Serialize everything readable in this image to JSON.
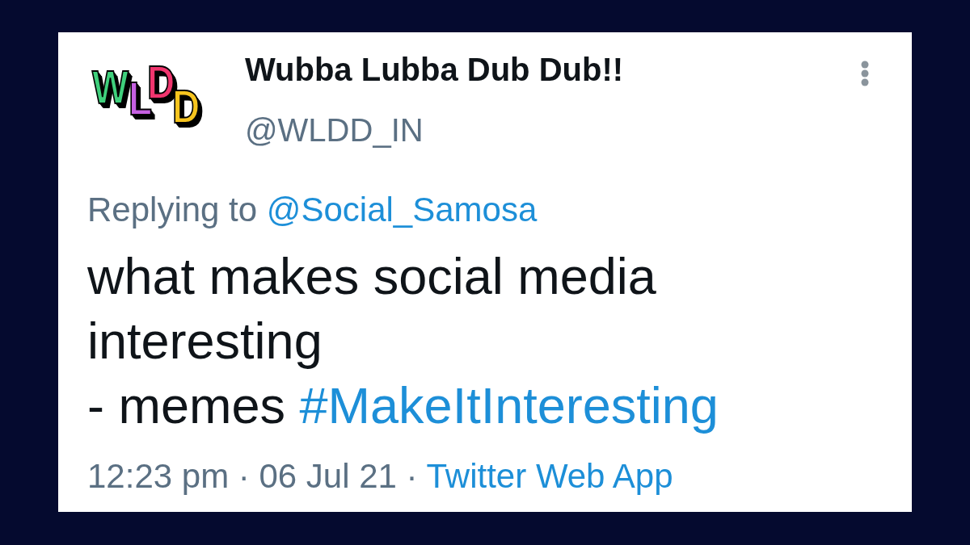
{
  "tweet": {
    "avatar": {
      "letters": [
        {
          "text": "W",
          "color": "#3fd07c"
        },
        {
          "text": "L",
          "color": "#c660e2"
        },
        {
          "text": "D",
          "color": "#f0356e"
        },
        {
          "text": "D",
          "color": "#f6c41e"
        }
      ]
    },
    "display_name": "Wubba Lubba Dub Dub!!",
    "handle": "@WLDD_IN",
    "reply_context": {
      "label": "Replying to",
      "mention": "@Social_Samosa"
    },
    "body": [
      {
        "kind": "text",
        "text": "what makes social media\ninteresting\n- memes"
      },
      {
        "kind": "hashtag",
        "text": "#MakeItInteresting"
      }
    ],
    "meta": [
      {
        "kind": "text",
        "text": "12:23 pm"
      },
      {
        "kind": "separator",
        "text": "·"
      },
      {
        "kind": "text",
        "text": "06 Jul 21"
      },
      {
        "kind": "separator",
        "text": "·"
      },
      {
        "kind": "link",
        "text": "Twitter Web App"
      }
    ]
  }
}
